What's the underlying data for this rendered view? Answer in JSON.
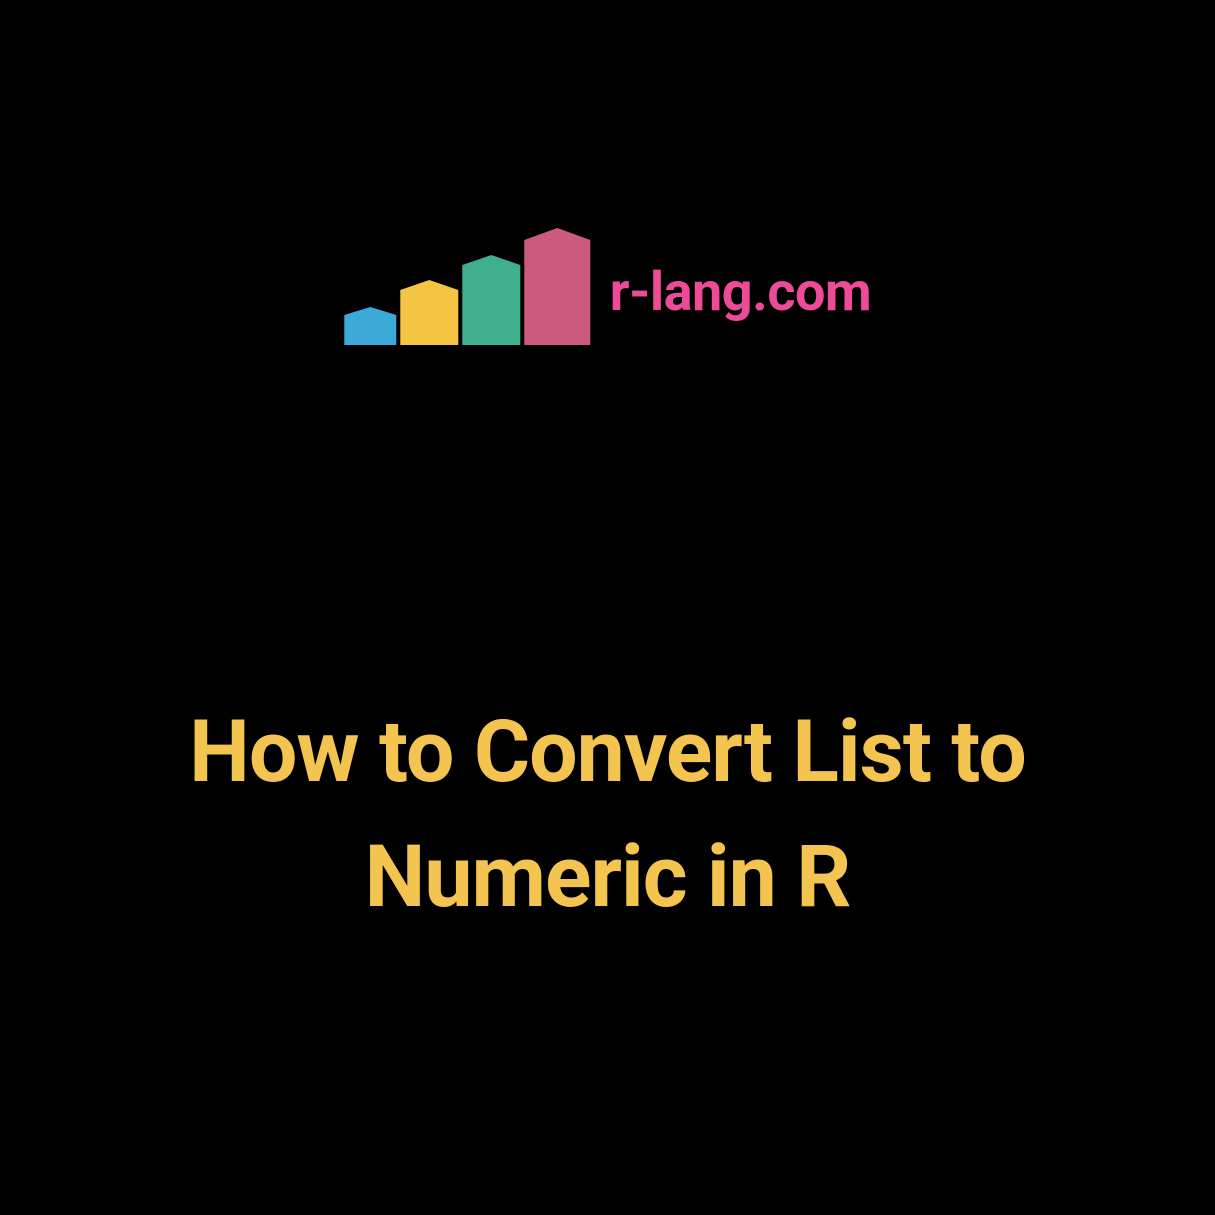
{
  "logo": {
    "domain": "r-lang.com",
    "bars": [
      {
        "name": "bar-blue",
        "color": "#3DA9D9"
      },
      {
        "name": "bar-yellow",
        "color": "#F4C542"
      },
      {
        "name": "bar-green",
        "color": "#3FAF8E"
      },
      {
        "name": "bar-pink",
        "color": "#CC5A7D"
      }
    ]
  },
  "title": "How to Convert List to Numeric in R",
  "colors": {
    "background": "#000000",
    "domain_text": "#EC4B98",
    "title_text": "#F4C450"
  }
}
